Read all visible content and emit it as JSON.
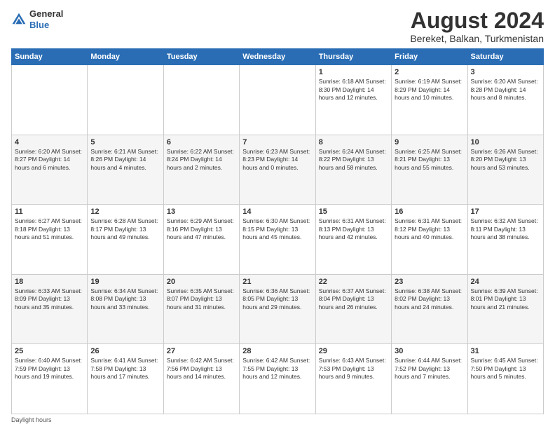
{
  "header": {
    "logo_line1": "General",
    "logo_line2": "Blue",
    "title": "August 2024",
    "location": "Bereket, Balkan, Turkmenistan"
  },
  "footer": {
    "note": "Daylight hours"
  },
  "days_of_week": [
    "Sunday",
    "Monday",
    "Tuesday",
    "Wednesday",
    "Thursday",
    "Friday",
    "Saturday"
  ],
  "weeks": [
    [
      {
        "day": "",
        "info": ""
      },
      {
        "day": "",
        "info": ""
      },
      {
        "day": "",
        "info": ""
      },
      {
        "day": "",
        "info": ""
      },
      {
        "day": "1",
        "info": "Sunrise: 6:18 AM\nSunset: 8:30 PM\nDaylight: 14 hours\nand 12 minutes."
      },
      {
        "day": "2",
        "info": "Sunrise: 6:19 AM\nSunset: 8:29 PM\nDaylight: 14 hours\nand 10 minutes."
      },
      {
        "day": "3",
        "info": "Sunrise: 6:20 AM\nSunset: 8:28 PM\nDaylight: 14 hours\nand 8 minutes."
      }
    ],
    [
      {
        "day": "4",
        "info": "Sunrise: 6:20 AM\nSunset: 8:27 PM\nDaylight: 14 hours\nand 6 minutes."
      },
      {
        "day": "5",
        "info": "Sunrise: 6:21 AM\nSunset: 8:26 PM\nDaylight: 14 hours\nand 4 minutes."
      },
      {
        "day": "6",
        "info": "Sunrise: 6:22 AM\nSunset: 8:24 PM\nDaylight: 14 hours\nand 2 minutes."
      },
      {
        "day": "7",
        "info": "Sunrise: 6:23 AM\nSunset: 8:23 PM\nDaylight: 14 hours\nand 0 minutes."
      },
      {
        "day": "8",
        "info": "Sunrise: 6:24 AM\nSunset: 8:22 PM\nDaylight: 13 hours\nand 58 minutes."
      },
      {
        "day": "9",
        "info": "Sunrise: 6:25 AM\nSunset: 8:21 PM\nDaylight: 13 hours\nand 55 minutes."
      },
      {
        "day": "10",
        "info": "Sunrise: 6:26 AM\nSunset: 8:20 PM\nDaylight: 13 hours\nand 53 minutes."
      }
    ],
    [
      {
        "day": "11",
        "info": "Sunrise: 6:27 AM\nSunset: 8:18 PM\nDaylight: 13 hours\nand 51 minutes."
      },
      {
        "day": "12",
        "info": "Sunrise: 6:28 AM\nSunset: 8:17 PM\nDaylight: 13 hours\nand 49 minutes."
      },
      {
        "day": "13",
        "info": "Sunrise: 6:29 AM\nSunset: 8:16 PM\nDaylight: 13 hours\nand 47 minutes."
      },
      {
        "day": "14",
        "info": "Sunrise: 6:30 AM\nSunset: 8:15 PM\nDaylight: 13 hours\nand 45 minutes."
      },
      {
        "day": "15",
        "info": "Sunrise: 6:31 AM\nSunset: 8:13 PM\nDaylight: 13 hours\nand 42 minutes."
      },
      {
        "day": "16",
        "info": "Sunrise: 6:31 AM\nSunset: 8:12 PM\nDaylight: 13 hours\nand 40 minutes."
      },
      {
        "day": "17",
        "info": "Sunrise: 6:32 AM\nSunset: 8:11 PM\nDaylight: 13 hours\nand 38 minutes."
      }
    ],
    [
      {
        "day": "18",
        "info": "Sunrise: 6:33 AM\nSunset: 8:09 PM\nDaylight: 13 hours\nand 35 minutes."
      },
      {
        "day": "19",
        "info": "Sunrise: 6:34 AM\nSunset: 8:08 PM\nDaylight: 13 hours\nand 33 minutes."
      },
      {
        "day": "20",
        "info": "Sunrise: 6:35 AM\nSunset: 8:07 PM\nDaylight: 13 hours\nand 31 minutes."
      },
      {
        "day": "21",
        "info": "Sunrise: 6:36 AM\nSunset: 8:05 PM\nDaylight: 13 hours\nand 29 minutes."
      },
      {
        "day": "22",
        "info": "Sunrise: 6:37 AM\nSunset: 8:04 PM\nDaylight: 13 hours\nand 26 minutes."
      },
      {
        "day": "23",
        "info": "Sunrise: 6:38 AM\nSunset: 8:02 PM\nDaylight: 13 hours\nand 24 minutes."
      },
      {
        "day": "24",
        "info": "Sunrise: 6:39 AM\nSunset: 8:01 PM\nDaylight: 13 hours\nand 21 minutes."
      }
    ],
    [
      {
        "day": "25",
        "info": "Sunrise: 6:40 AM\nSunset: 7:59 PM\nDaylight: 13 hours\nand 19 minutes."
      },
      {
        "day": "26",
        "info": "Sunrise: 6:41 AM\nSunset: 7:58 PM\nDaylight: 13 hours\nand 17 minutes."
      },
      {
        "day": "27",
        "info": "Sunrise: 6:42 AM\nSunset: 7:56 PM\nDaylight: 13 hours\nand 14 minutes."
      },
      {
        "day": "28",
        "info": "Sunrise: 6:42 AM\nSunset: 7:55 PM\nDaylight: 13 hours\nand 12 minutes."
      },
      {
        "day": "29",
        "info": "Sunrise: 6:43 AM\nSunset: 7:53 PM\nDaylight: 13 hours\nand 9 minutes."
      },
      {
        "day": "30",
        "info": "Sunrise: 6:44 AM\nSunset: 7:52 PM\nDaylight: 13 hours\nand 7 minutes."
      },
      {
        "day": "31",
        "info": "Sunrise: 6:45 AM\nSunset: 7:50 PM\nDaylight: 13 hours\nand 5 minutes."
      }
    ]
  ]
}
